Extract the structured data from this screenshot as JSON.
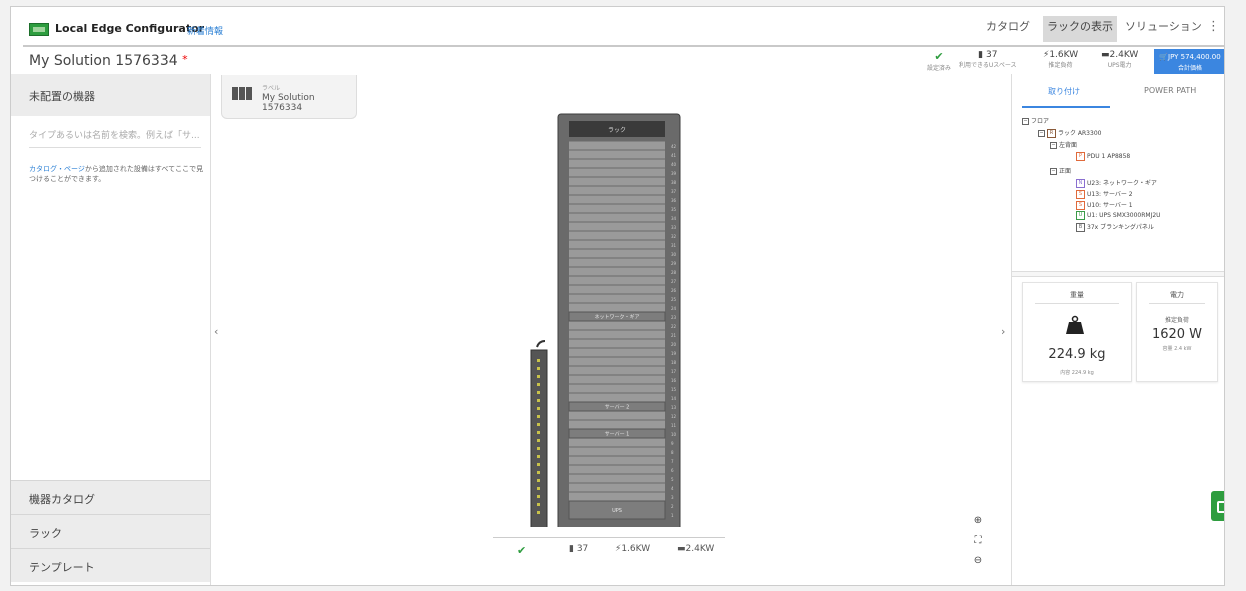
{
  "app": {
    "title": "Local Edge Configurator",
    "whats_new": "新着情報"
  },
  "nav": {
    "catalog": "カタログ",
    "rack_view": "ラックの表示",
    "solutions": "ソリューション",
    "more": "⋮"
  },
  "solution": {
    "name": "My Solution 1576334",
    "required_mark": "*"
  },
  "metrics": {
    "status": {
      "icon": "check-icon",
      "label": "設定済み"
    },
    "u_space": {
      "value": "37",
      "label": "利用できるUスペース"
    },
    "rated_load": {
      "value": "1.6KW",
      "label": "推定負荷"
    },
    "ups_power": {
      "value": "2.4KW",
      "label": "UPS電力"
    },
    "price": {
      "value": "JPY 574,400.00",
      "label": "合計価格"
    }
  },
  "left_panel": {
    "header": "未配置の機器",
    "search_placeholder": "タイプあるいは名前を検索。例えば「サ...",
    "help_link": "カタログ・ページ",
    "help_text": "から追加された設備はすべてここで見つけることができます。",
    "accordions": [
      "機器カタログ",
      "ラック",
      "テンプレート"
    ]
  },
  "rack_card": {
    "label": "ラベル",
    "name": "My Solution 1576334"
  },
  "rack": {
    "top_label": "ラック",
    "units": 42,
    "devices": [
      {
        "label": "ネットワーク・ギア",
        "u": 23
      },
      {
        "label": "サーバー 2",
        "u": 13
      },
      {
        "label": "サーバー 1",
        "u": 10
      },
      {
        "label": "UPS",
        "u": 1
      }
    ]
  },
  "bottom_metrics": {
    "u_space": "37",
    "rated_load": "1.6KW",
    "ups_power": "2.4KW"
  },
  "right_panel": {
    "tabs": {
      "mount": "取り付け",
      "power_path": "POWER PATH"
    },
    "tree": {
      "floor": "フロア",
      "rack": "ラック AR3300",
      "side": "左背面",
      "pdu": "PDU 1 AP8858",
      "front": "正面",
      "items": [
        {
          "badge": "N",
          "label": "U23: ネットワーク・ギア",
          "color": "#8a6fd0"
        },
        {
          "badge": "S",
          "label": "U13: サーバー 2",
          "color": "#e06a3b"
        },
        {
          "badge": "S",
          "label": "U10: サーバー 1",
          "color": "#e06a3b"
        },
        {
          "badge": "U",
          "label": "U1: UPS SMX3000RMJ2U",
          "color": "#3a9b48"
        },
        {
          "badge": "B",
          "label": "37x ブランキングパネル",
          "color": "#666666"
        }
      ],
      "rack_badge": "R",
      "pdu_badge": "P"
    },
    "weight": {
      "title": "重量",
      "value": "224.9 kg",
      "note": "内容 224.9 kg"
    },
    "power": {
      "title": "電力",
      "label": "推定負荷",
      "value": "1620 W",
      "note": "容量 2.4 kW"
    }
  }
}
